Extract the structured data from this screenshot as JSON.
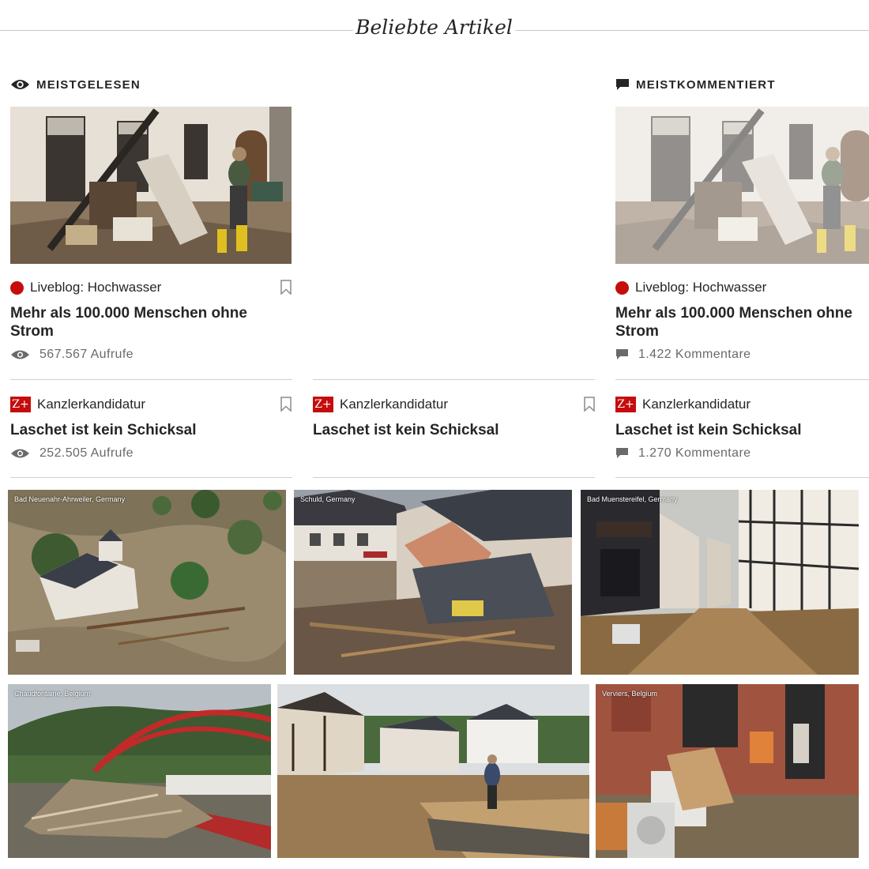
{
  "header": {
    "title": "Beliebte Artikel"
  },
  "sections": {
    "most_read": {
      "label": "MEISTGELESEN",
      "icon": "eye-icon"
    },
    "most_commented": {
      "label": "MEISTKOMMENTIERT",
      "icon": "comment-icon"
    }
  },
  "col_left": {
    "article1": {
      "kicker": "Liveblog: Hochwasser",
      "headline": "Mehr als 100.000 Menschen ohne Strom",
      "stat": "567.567 Aufrufe"
    },
    "article2": {
      "kicker": "Kanzlerkandidatur",
      "headline": "Laschet ist kein Schicksal",
      "stat": "252.505 Aufrufe"
    }
  },
  "col_middle": {
    "article2": {
      "kicker": "Kanzlerkandidatur",
      "headline": "Laschet ist kein Schicksal"
    }
  },
  "col_right": {
    "article1": {
      "kicker": "Liveblog: Hochwasser",
      "headline": "Mehr als 100.000 Menschen ohne Strom",
      "stat": "1.422 Kommentare"
    },
    "article2": {
      "kicker": "Kanzlerkandidatur",
      "headline": "Laschet ist kein Schicksal",
      "stat": "1.270 Kommentare"
    }
  },
  "zplus_label": "Z+",
  "photos": [
    {
      "location": "Bad Neuenahr-Ahrweiler, Germany"
    },
    {
      "location": "Schuld, Germany"
    },
    {
      "location": "Bad Muenstereifel, Germany"
    },
    {
      "location": "Chaudfontaine, Belgium"
    },
    {
      "location": ""
    },
    {
      "location": "Verviers, Belgium"
    }
  ],
  "colors": {
    "accent": "#c50d0d",
    "text": "#252525",
    "muted": "#6a6a6a",
    "rule": "#d0d0d0"
  }
}
